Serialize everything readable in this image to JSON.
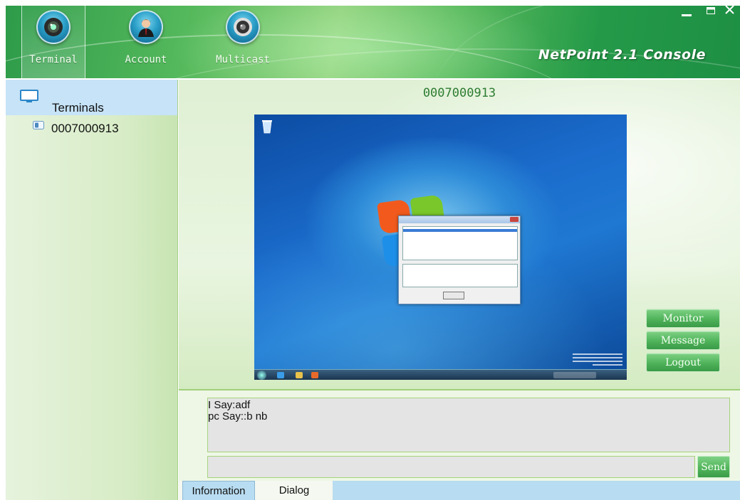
{
  "window": {
    "brand": "NetPoint 2.1 Console",
    "controls": [
      "minimize-icon",
      "maximize-icon",
      "close-icon"
    ]
  },
  "nav": {
    "items": [
      {
        "label": "Terminal",
        "icon": "webcam-icon",
        "active": true
      },
      {
        "label": "Account",
        "icon": "user-icon",
        "active": false
      },
      {
        "label": "Multicast",
        "icon": "speaker-icon",
        "active": false
      }
    ]
  },
  "sidebar": {
    "root": {
      "label": "Terminals",
      "icon": "monitor-icon"
    },
    "items": [
      {
        "label": "0007000913",
        "icon": "terminal-icon"
      }
    ]
  },
  "main": {
    "title": "0007000913",
    "buttons": {
      "monitor": "Monitor",
      "message": "Message",
      "logout": "Logout"
    }
  },
  "chat": {
    "lines": [
      "I Say:adf",
      "pc Say::b nb"
    ],
    "input_value": "",
    "send_label": "Send"
  },
  "tabs": [
    {
      "label": "Information",
      "active": true
    },
    {
      "label": "Dialog",
      "active": false
    }
  ],
  "colors": {
    "banner_green": "#2d9b49",
    "button_green": "#4fb35a",
    "title_green": "#2e7d32",
    "tree_selected": "#c6e3f7",
    "tab_blue": "#b8dcf1"
  }
}
